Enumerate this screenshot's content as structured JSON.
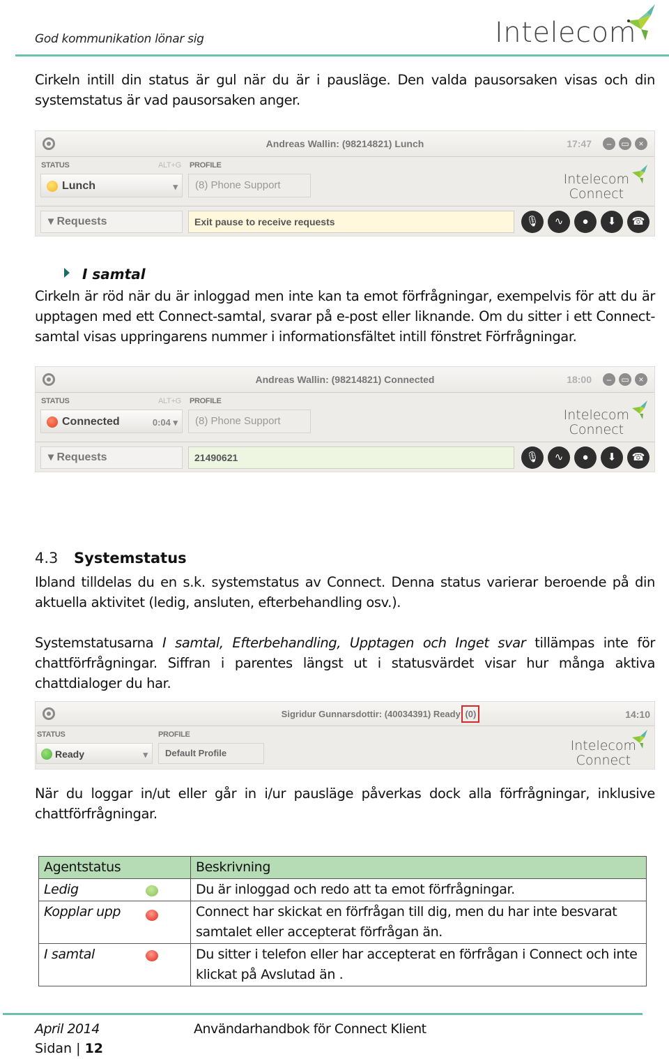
{
  "header": {
    "tagline": "God kommunikation lönar sig",
    "brand": "Intelecom"
  },
  "intro_paragraph": "Cirkeln intill din status är gul när du är i pausläge. Den valda pausorsaken visas och din systemstatus är vad pausorsaken anger.",
  "client_lunch": {
    "title": "Andreas Wallin: (98214821) Lunch",
    "time": "17:47",
    "status_label": "STATUS",
    "shortcut": "ALT+G",
    "profile_label": "PROFILE",
    "status_value": "Lunch",
    "status_color": "#f2b51c",
    "status_extra": "▾",
    "profile_value": "(8) Phone Support",
    "logo_line1": "Intelecom",
    "logo_line2": "Connect",
    "requests_label": "▾ Requests",
    "info_text": "Exit pause to receive requests",
    "info_bg": "#fff8dc"
  },
  "section_i_samtal": {
    "heading": "I samtal",
    "paragraph": "Cirkeln är röd när du är inloggad men inte kan ta emot förfrågningar, exempelvis för att du är upptagen med ett Connect-samtal, svarar på e-post eller liknande. Om du sitter i ett Connect-samtal visas uppringarens nummer i informationsfältet intill fönstret Förfrågningar."
  },
  "client_connected": {
    "title": "Andreas Wallin: (98214821) Connected",
    "time": "18:00",
    "status_label": "STATUS",
    "shortcut": "ALT+G",
    "profile_label": "PROFILE",
    "status_value": "Connected",
    "status_color": "#e2401f",
    "status_extra": "0:04 ▾",
    "profile_value": "(8) Phone Support",
    "logo_line1": "Intelecom",
    "logo_line2": "Connect",
    "requests_label": "▾ Requests",
    "info_text": "21490621",
    "info_bg": "#eef6e2"
  },
  "controls": {
    "icons": [
      "mute-mic-icon",
      "waveform-icon",
      "record-icon",
      "transfer-down-icon",
      "hangup-icon"
    ],
    "glyphs": [
      "🎙",
      "∿",
      "●",
      "⬇",
      "☎"
    ]
  },
  "section_43": {
    "number": "4.3",
    "title": "Systemstatus",
    "paragraph1": "Ibland tilldelas du en s.k. systemstatus av Connect. Denna status varierar beroende på din aktuella aktivitet (ledig, ansluten, efterbehandling osv.).",
    "paragraph2_pre": "Systemstatusarna ",
    "paragraph2_italic": "I samtal, Efterbehandling, Upptagen och Inget svar",
    "paragraph2_post": " tillämpas inte för chattförfrågningar. Siffran i parentes längst ut i statusvärdet visar hur många aktiva chattdialoger du har."
  },
  "client_ready": {
    "title_main": "Sigridur Gunnarsdottir: (40034391) Ready ",
    "title_count": "(0)",
    "time": "14:10",
    "status_label": "STATUS",
    "profile_label": "PROFILE",
    "status_value": "Ready",
    "status_color": "#4bb33a",
    "status_extra": "▾",
    "profile_value": "Default Profile",
    "logo_line1": "Intelecom",
    "logo_line2": "Connect"
  },
  "pause_paragraph": "När du loggar in/ut eller går in i/ur pausläge påverkas dock alla förfrågningar, inklusive chattförfrågningar.",
  "status_table": {
    "headers": [
      "Agentstatus",
      "Beskrivning"
    ],
    "rows": [
      {
        "status": "Ledig",
        "color": "#86c25a",
        "description": "Du är inloggad och redo att ta emot förfrågningar."
      },
      {
        "status": "Kopplar upp",
        "color": "#e3261e",
        "description": "Connect har skickat en förfrågan till dig, men du har inte besvarat samtalet eller accepterat förfrågan än."
      },
      {
        "status": "I samtal",
        "color": "#e3261e",
        "description": "Du sitter i telefon eller har accepterat en förfrågan i Connect och inte klickat på Avslutad än ."
      }
    ]
  },
  "footer": {
    "date": "April 2014",
    "title": "Användarhandbok för Connect Klient",
    "page_prefix": "Sidan | ",
    "page_number": "12"
  }
}
